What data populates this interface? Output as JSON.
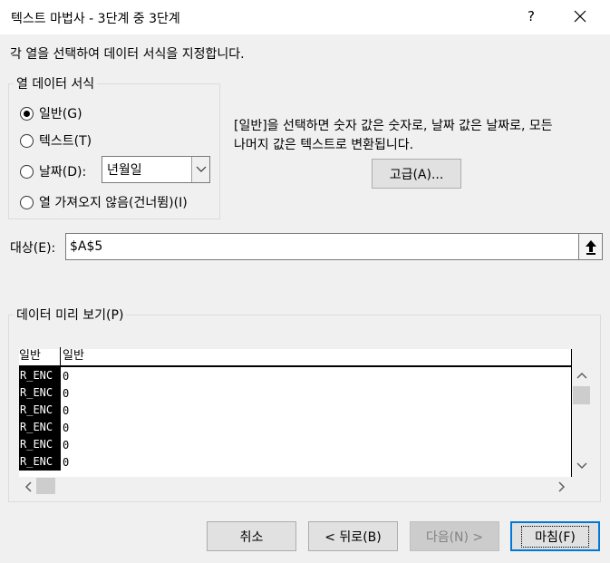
{
  "window": {
    "title": "텍스트 마법사 - 3단계 중 3단계",
    "help": "?"
  },
  "instruction": "각 열을 선택하여 데이터 서식을 지정합니다.",
  "column_format": {
    "legend": "열 데이터 서식",
    "options": [
      {
        "label": "일반(G)",
        "checked": true
      },
      {
        "label": "텍스트(T)",
        "checked": false
      },
      {
        "label": "날짜(D):",
        "checked": false
      },
      {
        "label": "열 가져오지 않음(건너뜀)(I)",
        "checked": false
      }
    ],
    "date_format": "년월일"
  },
  "description": {
    "line1": "[일반]을 선택하면 숫자 값은 숫자로, 날짜 값은 날짜로, 모든",
    "line2": "나머지 값은 텍스트로 변환됩니다."
  },
  "advanced_button": "고급(A)...",
  "destination": {
    "label": "대상(E):",
    "value": "$A$5"
  },
  "preview": {
    "legend": "데이터 미리 보기(P)",
    "headers": [
      "일반",
      "일반"
    ],
    "rows": [
      [
        "R_ENC",
        "0"
      ],
      [
        "R_ENC",
        "0"
      ],
      [
        "R_ENC",
        "0"
      ],
      [
        "R_ENC",
        "0"
      ],
      [
        "R_ENC",
        "0"
      ],
      [
        "R_ENC",
        "0"
      ]
    ]
  },
  "buttons": {
    "cancel": "취소",
    "back": "< 뒤로(B)",
    "next": "다음(N) >",
    "finish": "마침(F)"
  }
}
